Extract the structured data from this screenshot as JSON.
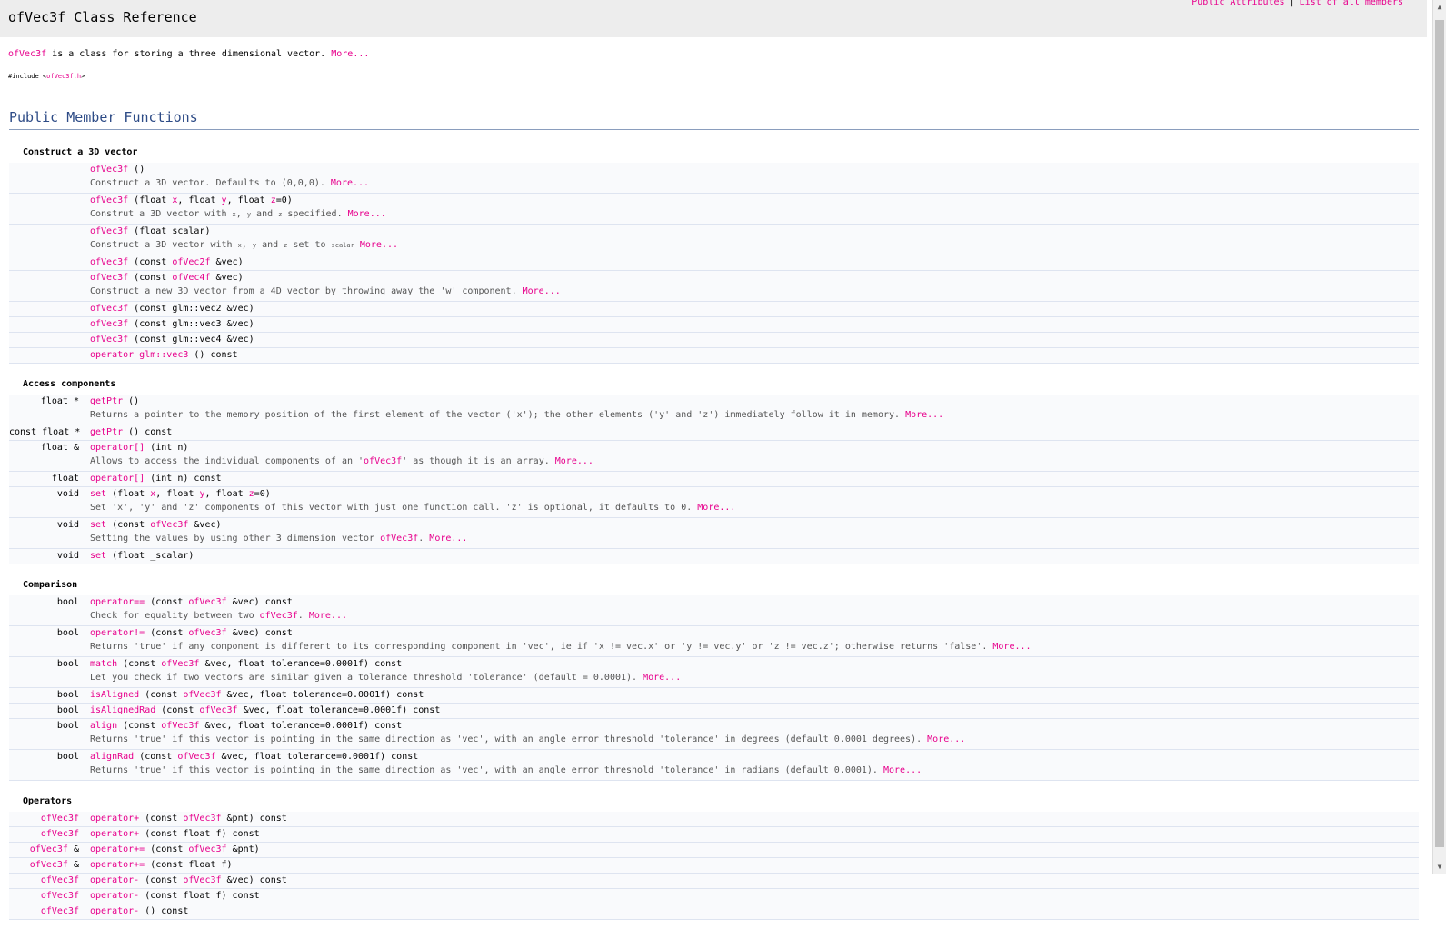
{
  "header": {
    "title": "ofVec3f Class Reference",
    "link_public_attributes": "Public Attributes",
    "link_separator": "|",
    "link_all_members": "List of all members"
  },
  "brief": {
    "class_name": "ofVec3f",
    "text": " is a class for storing a three dimensional vector. ",
    "more": "More..."
  },
  "include": {
    "prefix": "#include <",
    "file": "ofVec3f.h",
    "suffix": ">"
  },
  "section": {
    "title": "Public Member Functions"
  },
  "groups": [
    {
      "title": "Construct a 3D vector",
      "rows": [
        {
          "ret": [],
          "sig": [
            {
              "t": "ofVec3f",
              "l": true
            },
            {
              "t": " ()"
            }
          ],
          "desc": [
            {
              "t": "Construct a 3D vector. Defaults to (0,0,0). "
            },
            {
              "t": "More...",
              "l": true
            }
          ]
        },
        {
          "ret": [],
          "sig": [
            {
              "t": "ofVec3f",
              "l": true
            },
            {
              "t": " (float "
            },
            {
              "t": "x",
              "l": true
            },
            {
              "t": ", float "
            },
            {
              "t": "y",
              "l": true
            },
            {
              "t": ", float "
            },
            {
              "t": "z",
              "l": true
            },
            {
              "t": "=0)"
            }
          ],
          "desc": [
            {
              "t": "Construt a 3D vector with "
            },
            {
              "t": "x",
              "s": true
            },
            {
              "t": ", "
            },
            {
              "t": "y",
              "s": true
            },
            {
              "t": " and "
            },
            {
              "t": "z",
              "s": true
            },
            {
              "t": " specified. "
            },
            {
              "t": "More...",
              "l": true
            }
          ]
        },
        {
          "ret": [],
          "sig": [
            {
              "t": "ofVec3f",
              "l": true
            },
            {
              "t": " (float scalar)"
            }
          ],
          "desc": [
            {
              "t": "Construct a 3D vector with "
            },
            {
              "t": "x",
              "s": true
            },
            {
              "t": ", "
            },
            {
              "t": "y",
              "s": true
            },
            {
              "t": " and "
            },
            {
              "t": "z",
              "s": true
            },
            {
              "t": " set to "
            },
            {
              "t": "scalar",
              "s": true
            },
            {
              "t": " "
            },
            {
              "t": "More...",
              "l": true
            }
          ]
        },
        {
          "ret": [],
          "sig": [
            {
              "t": "ofVec3f",
              "l": true
            },
            {
              "t": " (const "
            },
            {
              "t": "ofVec2f",
              "l": true
            },
            {
              "t": " &vec)"
            }
          ],
          "desc": []
        },
        {
          "ret": [],
          "sig": [
            {
              "t": "ofVec3f",
              "l": true
            },
            {
              "t": " (const "
            },
            {
              "t": "ofVec4f",
              "l": true
            },
            {
              "t": " &vec)"
            }
          ],
          "desc": [
            {
              "t": "Construct a new 3D vector from a 4D vector by throwing away the 'w' component. "
            },
            {
              "t": "More...",
              "l": true
            }
          ]
        },
        {
          "ret": [],
          "sig": [
            {
              "t": "ofVec3f",
              "l": true
            },
            {
              "t": " (const glm::vec2 &vec)"
            }
          ],
          "desc": []
        },
        {
          "ret": [],
          "sig": [
            {
              "t": "ofVec3f",
              "l": true
            },
            {
              "t": " (const glm::vec3 &vec)"
            }
          ],
          "desc": []
        },
        {
          "ret": [],
          "sig": [
            {
              "t": "ofVec3f",
              "l": true
            },
            {
              "t": " (const glm::vec4 &vec)"
            }
          ],
          "desc": []
        },
        {
          "ret": [],
          "sig": [
            {
              "t": "operator glm::vec3",
              "l": true
            },
            {
              "t": " () const"
            }
          ],
          "desc": []
        }
      ]
    },
    {
      "title": "Access components",
      "rows": [
        {
          "ret": [
            {
              "t": "float *"
            }
          ],
          "sig": [
            {
              "t": "getPtr",
              "l": true
            },
            {
              "t": " ()"
            }
          ],
          "desc": [
            {
              "t": "Returns a pointer to the memory position of the first element of the vector ('x'); the other elements ('y' and 'z') immediately follow it in memory. "
            },
            {
              "t": "More...",
              "l": true
            }
          ]
        },
        {
          "ret": [
            {
              "t": "const float *"
            }
          ],
          "sig": [
            {
              "t": "getPtr",
              "l": true
            },
            {
              "t": " () const"
            }
          ],
          "desc": []
        },
        {
          "ret": [
            {
              "t": "float &"
            }
          ],
          "sig": [
            {
              "t": "operator[]",
              "l": true
            },
            {
              "t": " (int n)"
            }
          ],
          "desc": [
            {
              "t": "Allows to access the individual components of an '"
            },
            {
              "t": "ofVec3f",
              "l": true
            },
            {
              "t": "' as though it is an array. "
            },
            {
              "t": "More...",
              "l": true
            }
          ]
        },
        {
          "ret": [
            {
              "t": "float"
            }
          ],
          "sig": [
            {
              "t": "operator[]",
              "l": true
            },
            {
              "t": " (int n) const"
            }
          ],
          "desc": []
        },
        {
          "ret": [
            {
              "t": "void"
            }
          ],
          "sig": [
            {
              "t": "set",
              "l": true
            },
            {
              "t": " (float "
            },
            {
              "t": "x",
              "l": true
            },
            {
              "t": ", float "
            },
            {
              "t": "y",
              "l": true
            },
            {
              "t": ", float "
            },
            {
              "t": "z",
              "l": true
            },
            {
              "t": "=0)"
            }
          ],
          "desc": [
            {
              "t": "Set 'x', 'y' and 'z' components of this vector with just one function call. 'z' is optional, it defaults to 0. "
            },
            {
              "t": "More...",
              "l": true
            }
          ]
        },
        {
          "ret": [
            {
              "t": "void"
            }
          ],
          "sig": [
            {
              "t": "set",
              "l": true
            },
            {
              "t": " (const "
            },
            {
              "t": "ofVec3f",
              "l": true
            },
            {
              "t": " &vec)"
            }
          ],
          "desc": [
            {
              "t": "Setting the values by using other 3 dimension vector "
            },
            {
              "t": "ofVec3f",
              "l": true
            },
            {
              "t": ". "
            },
            {
              "t": "More...",
              "l": true
            }
          ]
        },
        {
          "ret": [
            {
              "t": "void"
            }
          ],
          "sig": [
            {
              "t": "set",
              "l": true
            },
            {
              "t": " (float _scalar)"
            }
          ],
          "desc": []
        }
      ]
    },
    {
      "title": "Comparison",
      "rows": [
        {
          "ret": [
            {
              "t": "bool"
            }
          ],
          "sig": [
            {
              "t": "operator==",
              "l": true
            },
            {
              "t": " (const "
            },
            {
              "t": "ofVec3f",
              "l": true
            },
            {
              "t": " &vec) const"
            }
          ],
          "desc": [
            {
              "t": "Check for equality between two "
            },
            {
              "t": "ofVec3f",
              "l": true
            },
            {
              "t": ". "
            },
            {
              "t": "More...",
              "l": true
            }
          ]
        },
        {
          "ret": [
            {
              "t": "bool"
            }
          ],
          "sig": [
            {
              "t": "operator!=",
              "l": true
            },
            {
              "t": " (const "
            },
            {
              "t": "ofVec3f",
              "l": true
            },
            {
              "t": " &vec) const"
            }
          ],
          "desc": [
            {
              "t": "Returns 'true' if any component is different to its corresponding component in 'vec', ie if 'x != vec.x' or 'y != vec.y' or 'z != vec.z'; otherwise returns 'false'. "
            },
            {
              "t": "More...",
              "l": true
            }
          ]
        },
        {
          "ret": [
            {
              "t": "bool"
            }
          ],
          "sig": [
            {
              "t": "match",
              "l": true
            },
            {
              "t": " (const "
            },
            {
              "t": "ofVec3f",
              "l": true
            },
            {
              "t": " &vec, float tolerance=0.0001f) const"
            }
          ],
          "desc": [
            {
              "t": "Let you check if two vectors are similar given a tolerance threshold 'tolerance' (default = 0.0001). "
            },
            {
              "t": "More...",
              "l": true
            }
          ]
        },
        {
          "ret": [
            {
              "t": "bool"
            }
          ],
          "sig": [
            {
              "t": "isAligned",
              "l": true
            },
            {
              "t": " (const "
            },
            {
              "t": "ofVec3f",
              "l": true
            },
            {
              "t": " &vec, float tolerance=0.0001f) const"
            }
          ],
          "desc": []
        },
        {
          "ret": [
            {
              "t": "bool"
            }
          ],
          "sig": [
            {
              "t": "isAlignedRad",
              "l": true
            },
            {
              "t": " (const "
            },
            {
              "t": "ofVec3f",
              "l": true
            },
            {
              "t": " &vec, float tolerance=0.0001f) const"
            }
          ],
          "desc": []
        },
        {
          "ret": [
            {
              "t": "bool"
            }
          ],
          "sig": [
            {
              "t": "align",
              "l": true
            },
            {
              "t": " (const "
            },
            {
              "t": "ofVec3f",
              "l": true
            },
            {
              "t": " &vec, float tolerance=0.0001f) const"
            }
          ],
          "desc": [
            {
              "t": "Returns 'true' if this vector is pointing in the same direction as 'vec', with an angle error threshold 'tolerance' in degrees (default 0.0001 degrees). "
            },
            {
              "t": "More...",
              "l": true
            }
          ]
        },
        {
          "ret": [
            {
              "t": "bool"
            }
          ],
          "sig": [
            {
              "t": "alignRad",
              "l": true
            },
            {
              "t": " (const "
            },
            {
              "t": "ofVec3f",
              "l": true
            },
            {
              "t": " &vec, float tolerance=0.0001f) const"
            }
          ],
          "desc": [
            {
              "t": "Returns 'true' if this vector is pointing in the same direction as 'vec', with an angle error threshold 'tolerance' in radians (default 0.0001). "
            },
            {
              "t": "More...",
              "l": true
            }
          ]
        }
      ]
    },
    {
      "title": "Operators",
      "rows": [
        {
          "ret": [
            {
              "t": "ofVec3f",
              "l": true
            }
          ],
          "sig": [
            {
              "t": "operator+",
              "l": true
            },
            {
              "t": " (const "
            },
            {
              "t": "ofVec3f",
              "l": true
            },
            {
              "t": " &pnt) const"
            }
          ],
          "desc": []
        },
        {
          "ret": [
            {
              "t": "ofVec3f",
              "l": true
            }
          ],
          "sig": [
            {
              "t": "operator+",
              "l": true
            },
            {
              "t": " (const float f) const"
            }
          ],
          "desc": []
        },
        {
          "ret": [
            {
              "t": "ofVec3f",
              "l": true
            },
            {
              "t": " &"
            }
          ],
          "sig": [
            {
              "t": "operator+=",
              "l": true
            },
            {
              "t": " (const "
            },
            {
              "t": "ofVec3f",
              "l": true
            },
            {
              "t": " &pnt)"
            }
          ],
          "desc": []
        },
        {
          "ret": [
            {
              "t": "ofVec3f",
              "l": true
            },
            {
              "t": " &"
            }
          ],
          "sig": [
            {
              "t": "operator+=",
              "l": true
            },
            {
              "t": " (const float f)"
            }
          ],
          "desc": []
        },
        {
          "ret": [
            {
              "t": "ofVec3f",
              "l": true
            }
          ],
          "sig": [
            {
              "t": "operator-",
              "l": true
            },
            {
              "t": " (const "
            },
            {
              "t": "ofVec3f",
              "l": true
            },
            {
              "t": " &vec) const"
            }
          ],
          "desc": []
        },
        {
          "ret": [
            {
              "t": "ofVec3f",
              "l": true
            }
          ],
          "sig": [
            {
              "t": "operator-",
              "l": true
            },
            {
              "t": " (const float f) const"
            }
          ],
          "desc": []
        },
        {
          "ret": [
            {
              "t": "ofVec3f",
              "l": true
            }
          ],
          "sig": [
            {
              "t": "operator-",
              "l": true
            },
            {
              "t": " () const"
            }
          ],
          "desc": []
        }
      ]
    }
  ],
  "scrollbar": {
    "up_icon": "▲",
    "down_icon": "▼"
  },
  "colors": {
    "link": "#e7008c",
    "heading": "#2d4b86",
    "header_bg": "#ededed",
    "row_bg": "#f9fafc"
  }
}
